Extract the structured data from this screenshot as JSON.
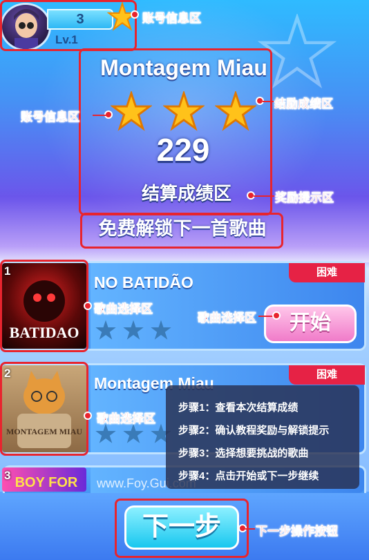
{
  "account": {
    "star_count": "3",
    "level": "Lv.1"
  },
  "result": {
    "song_title": "Montagem Miau",
    "star_rating": 3,
    "score": "229",
    "label": "结算成绩区",
    "unlock_tip": "免费解锁下一首歌曲"
  },
  "songs": [
    {
      "index": "1",
      "title": "NO BATIDÃO",
      "difficulty": "困难",
      "cover_text": "BATIDAO",
      "start_label": "开始"
    },
    {
      "index": "2",
      "title": "Montagem Miau",
      "difficulty": "困难",
      "cover_text": "MONTAGEM MIAU"
    },
    {
      "index": "3",
      "cover_text": "BOY FOR"
    }
  ],
  "annotations": {
    "account_top": "账号信息区",
    "account_left": "账号信息区",
    "achievement": "结励成绩区",
    "reward_tip": "奖励提示区",
    "song_select_1": "歌曲选择区",
    "song_select_start": "歌曲选择区",
    "song_select_2": "歌曲选择区",
    "next_button": "下一步操作按钮"
  },
  "steps": [
    "步骤1：查看本次结算成绩",
    "步骤2：确认教程奖励与解锁提示",
    "步骤3：选择想要挑战的歌曲",
    "步骤4：点击开始或下一步继续"
  ],
  "watermark": "www.Foy.Gui.com",
  "next_button_label": "下一步",
  "colors": {
    "annotation_red": "#e8242e",
    "difficulty_red": "#e62245",
    "start_pink": "#f07bc9",
    "next_cyan": "#19c7ef",
    "star_gold": "#ffc21a"
  }
}
